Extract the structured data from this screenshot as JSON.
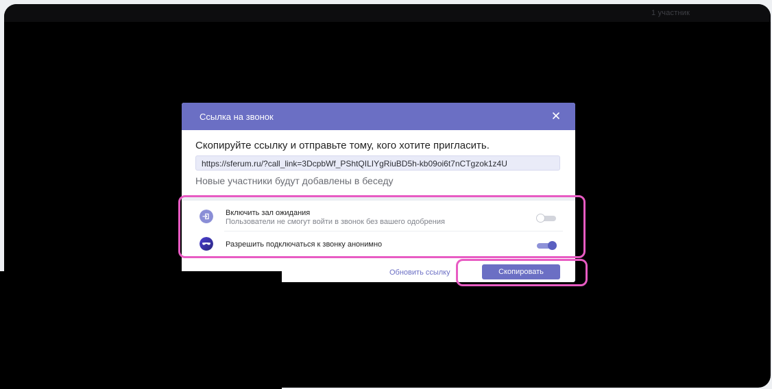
{
  "topbar": {
    "participants_count": "1 участник"
  },
  "modal": {
    "title": "Ссылка на звонок",
    "instruction": "Скопируйте ссылку и отправьте тому, кого хотите пригласить.",
    "link": "https://sferum.ru/?call_link=3DcpbWf_PShtQILIYgRiuBD5h-kb09oi6t7nCTgzok1z4U",
    "note": "Новые участники будут добавлены в беседу",
    "options": [
      {
        "icon": "enter-icon",
        "title": "Включить зал ожидания",
        "subtitle": "Пользователи не смогут войти в звонок без вашего одобрения",
        "enabled": false
      },
      {
        "icon": "anonymous-mask-icon",
        "title": "Разрешить подключаться к звонку анонимно",
        "enabled": true
      }
    ],
    "refresh_label": "Обновить ссылку",
    "copy_label": "Скопировать"
  },
  "colors": {
    "accent": "#6b6fc4",
    "highlight": "#e85bc3",
    "background": "#000000"
  }
}
